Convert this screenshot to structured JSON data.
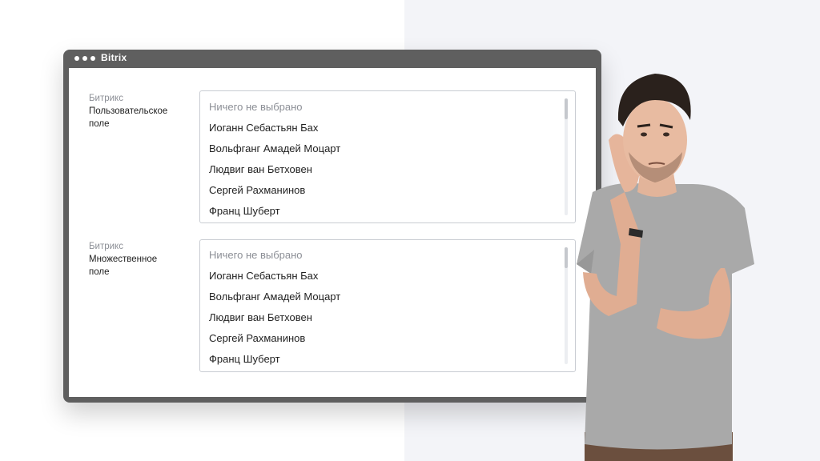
{
  "window": {
    "title": "Bitrix"
  },
  "fields": [
    {
      "category": "Битрикс",
      "name_lines": [
        "Пользовательское",
        "поле"
      ],
      "options": [
        "Ничего не выбрано",
        "Иоганн Себастьян Бах",
        "Вольфганг Амадей Моцарт",
        "Людвиг ван Бетховен",
        "Сергей Рахманинов",
        "Франц Шуберт"
      ]
    },
    {
      "category": "Битрикс",
      "name_lines": [
        "Множественное",
        "поле"
      ],
      "options": [
        "Ничего не выбрано",
        "Иоганн Себастьян Бах",
        "Вольфганг Амадей Моцарт",
        "Людвиг ван Бетховен",
        "Сергей Рахманинов",
        "Франц Шуберт"
      ]
    }
  ],
  "colors": {
    "window_frame": "#5f5f5f",
    "right_background": "#f3f4f8",
    "placeholder_text": "#8c8f96"
  }
}
